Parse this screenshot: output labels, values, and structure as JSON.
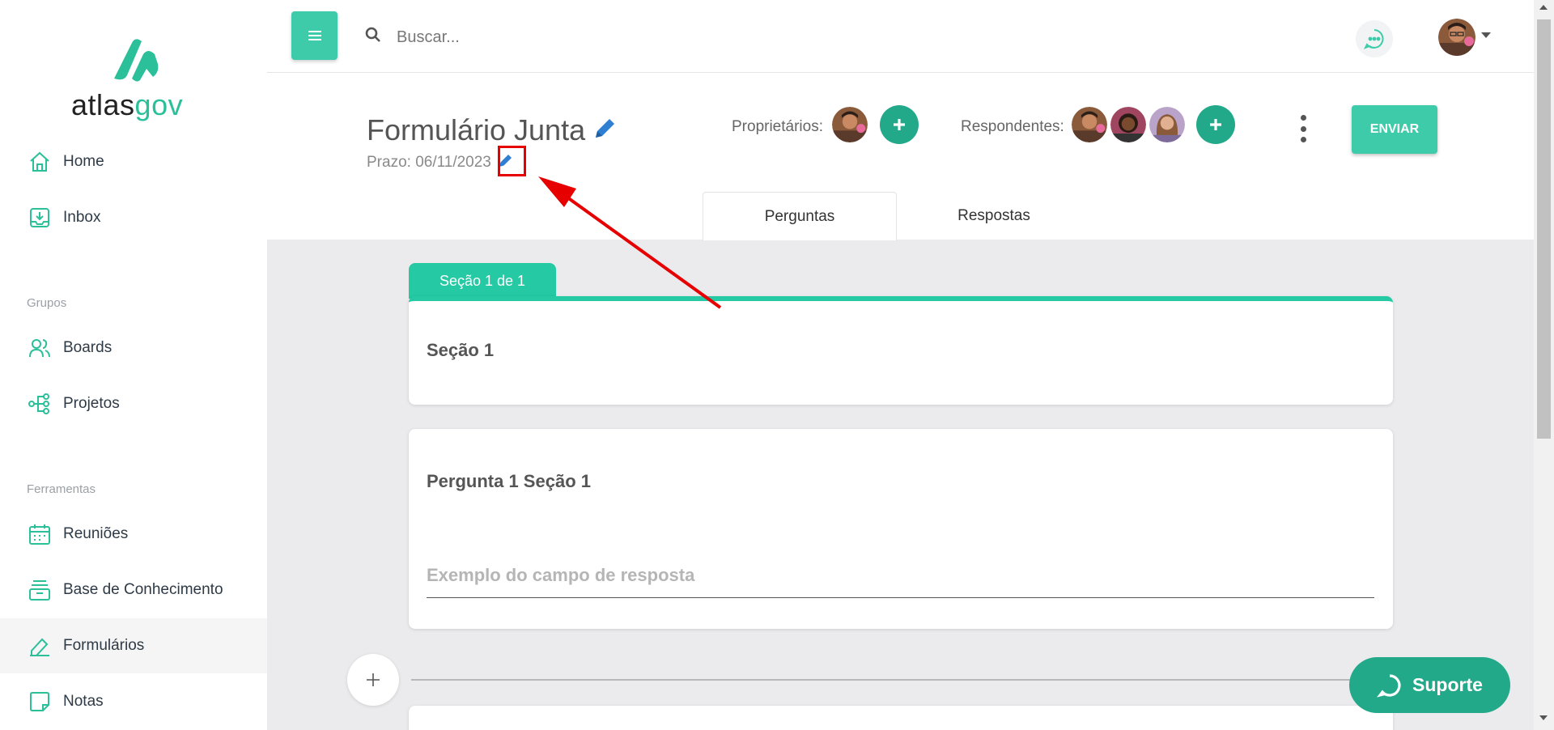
{
  "sidebar": {
    "logo": {
      "text_main": "atlas",
      "text_accent": "gov"
    },
    "items": [
      {
        "label": "Home",
        "icon": "home-icon"
      },
      {
        "label": "Inbox",
        "icon": "inbox-icon"
      }
    ],
    "groups_label": "Grupos",
    "group_items": [
      {
        "label": "Boards",
        "icon": "users-icon"
      },
      {
        "label": "Projetos",
        "icon": "project-tree-icon"
      }
    ],
    "tools_label": "Ferramentas",
    "tool_items": [
      {
        "label": "Reuniões",
        "icon": "calendar-icon"
      },
      {
        "label": "Base de Conhecimento",
        "icon": "archive-box-icon"
      },
      {
        "label": "Formulários",
        "icon": "form-pen-icon",
        "active": true
      },
      {
        "label": "Notas",
        "icon": "note-icon"
      }
    ]
  },
  "topbar": {
    "search_placeholder": "Buscar..."
  },
  "form": {
    "title": "Formulário Junta",
    "deadline": "Prazo: 06/11/2023",
    "owners_label": "Proprietários:",
    "respondents_label": "Respondentes:",
    "send_label": "ENVIAR",
    "tabs": [
      {
        "label": "Perguntas",
        "active": true
      },
      {
        "label": "Respostas",
        "active": false
      }
    ]
  },
  "content": {
    "section_tab": "Seção 1 de 1",
    "section_title": "Seção 1",
    "question_title": "Pergunta 1 Seção 1",
    "answer_example": "Exemplo do campo de resposta"
  },
  "support": {
    "label": "Suporte"
  },
  "colors": {
    "accent": "#3ecba9",
    "accent_dark": "#22a98a",
    "annotation_red": "#e60000",
    "edit_icon_blue": "#2f7fd3"
  }
}
